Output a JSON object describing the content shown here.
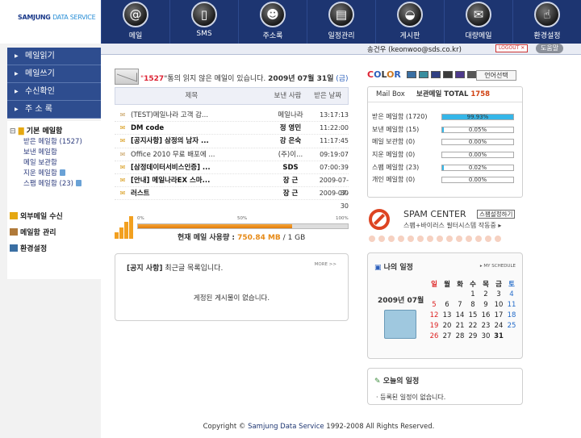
{
  "brand": {
    "logo": "SAMJUNG",
    "logo_sub": "DATA SERVICE"
  },
  "nav": [
    {
      "label": "메일",
      "icon": "at-icon",
      "glyph": "@"
    },
    {
      "label": "SMS",
      "icon": "phone-icon",
      "glyph": "▯"
    },
    {
      "label": "주소록",
      "icon": "person-icon",
      "glyph": "☻"
    },
    {
      "label": "일정관리",
      "icon": "notepad-icon",
      "glyph": "▤"
    },
    {
      "label": "게시판",
      "icon": "bowl-icon",
      "glyph": "◒"
    },
    {
      "label": "대량메일",
      "icon": "envelope-icon",
      "glyph": "✉"
    },
    {
      "label": "환경설정",
      "icon": "hand-icon",
      "glyph": "☝"
    }
  ],
  "user": {
    "text": "송건우 (keonwoo@sds.co.kr)",
    "logout": "LOGOUT ✕",
    "help": "도움말"
  },
  "sidebar": {
    "menu": [
      "메일읽기",
      "메일쓰기",
      "수신확인",
      "주 소 록"
    ],
    "tree_title": "기본 메일함",
    "folders": [
      "받은 메일함 (1527)",
      "보낸 메일함",
      "메일 보관함",
      "지운 메일함",
      "스팸 메일함 (23)"
    ],
    "tools": [
      "외부메일 수신",
      "메일함 관리",
      "환경설정"
    ]
  },
  "mail": {
    "count": "1527",
    "pre": "\"",
    "post": "\"통의 읽지 않은 메일이 있습니다.",
    "date": "2009년 07월 31일",
    "day": "(금)",
    "col_subject": "제목",
    "col_sender": "보낸 사람",
    "col_date": "받은 날짜",
    "rows": [
      {
        "subject": "(TEST)메일나라 고객 감...",
        "sender": "메일나라",
        "date": "13:17:13",
        "unread": false
      },
      {
        "subject": "DM code",
        "sender": "정 영민",
        "date": "11:22:00",
        "unread": true
      },
      {
        "subject": "[공지사항] 삼정의 남자 ...",
        "sender": "강 은숙",
        "date": "11:17:45",
        "unread": true
      },
      {
        "subject": "Office 2010 무료 배포에 ...",
        "sender": "(주)이...",
        "date": "09:19:07",
        "unread": false
      },
      {
        "subject": "[삼정데이터서비스인증] ...",
        "sender": "SDS",
        "date": "07:00:39",
        "unread": true
      },
      {
        "subject": "[안내] 메일나라EX 스마...",
        "sender": "장 근",
        "date": "2009-07-30",
        "unread": true
      },
      {
        "subject": "러스트",
        "sender": "장 근",
        "date": "2009-07-30",
        "unread": true
      }
    ]
  },
  "usage": {
    "tick0": "0%",
    "tick50": "50%",
    "tick100": "100%",
    "label": "현재 메일 사용량 :",
    "used": "750.84 MB",
    "sep": " / ",
    "total": "1 GB",
    "fraction": 0.733
  },
  "notice": {
    "tag": "[공지 사항]",
    "title": "최근글 목록입니다.",
    "more": "MORE >>",
    "empty": "게정된 게시물이 없습니다."
  },
  "colors": {
    "title": "COLOR",
    "lang": "언어선택",
    "swatches": [
      "#3a6fa3",
      "#3a8e9f",
      "#2f3f82",
      "#3b3b3b",
      "#4e3a8c",
      "#555555"
    ]
  },
  "mailbox": {
    "title": "Mail Box",
    "total_label": "보관메일 TOTAL",
    "total": "1758",
    "rows": [
      {
        "name": "받은 메일함 (1720)",
        "pct": "99.93%",
        "fraction": 0.9993
      },
      {
        "name": "보낸 메일함 (15)",
        "pct": "0.05%",
        "fraction": 0.0005
      },
      {
        "name": "메일 보관함 (0)",
        "pct": "0.00%",
        "fraction": 0
      },
      {
        "name": "지운 메일함 (0)",
        "pct": "0.00%",
        "fraction": 0
      },
      {
        "name": "스팸 메일함 (23)",
        "pct": "0.02%",
        "fraction": 0.0002
      },
      {
        "name": "개인 메일함 (0)",
        "pct": "0.00%",
        "fraction": 0
      }
    ]
  },
  "spam": {
    "title": "SPAM CENTER",
    "button": "스팸설정하기",
    "sub": "스팸+바이러스 필터시스템 작동중 ▸"
  },
  "schedule": {
    "title": "나의 일정",
    "more": "▸ MY SCHEDULE",
    "ym": "2009년 07월",
    "weekdays": [
      "일",
      "월",
      "화",
      "수",
      "목",
      "금",
      "토"
    ],
    "weeks": [
      [
        "",
        "",
        "",
        "1",
        "2",
        "3",
        "4"
      ],
      [
        "5",
        "6",
        "7",
        "8",
        "9",
        "10",
        "11"
      ],
      [
        "12",
        "13",
        "14",
        "15",
        "16",
        "17",
        "18"
      ],
      [
        "19",
        "20",
        "21",
        "22",
        "23",
        "24",
        "25"
      ],
      [
        "26",
        "27",
        "28",
        "29",
        "30",
        "31",
        ""
      ]
    ]
  },
  "today": {
    "title": "오늘의 일정",
    "empty": "· 등록된 일정이 없습니다."
  },
  "footer": {
    "pre": "Copyright © ",
    "name": "Samjung Data Service",
    "post": " 1992-2008 All Rights Reserved."
  }
}
